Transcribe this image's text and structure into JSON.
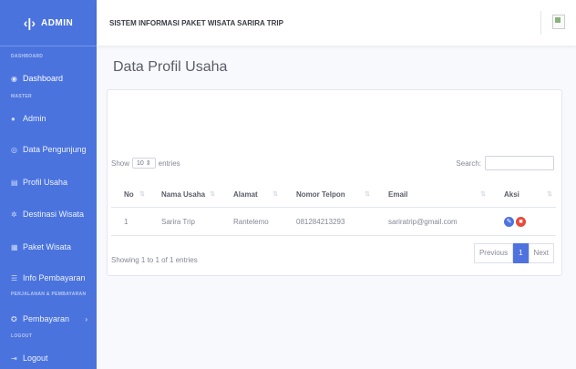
{
  "brand": {
    "name": "ADMIN",
    "logo": "‹|›"
  },
  "sidebar": {
    "sections": [
      "DASHBOARD",
      "MASTER",
      "PERJALANAN & PEMBAYARAN",
      "LOGOUT"
    ],
    "items": [
      {
        "label": "Dashboard",
        "icon": "dashboard-icon"
      },
      {
        "label": "Admin",
        "icon": "user-icon"
      },
      {
        "label": "Data Pengunjung",
        "icon": "users-icon"
      },
      {
        "label": "Profil Usaha",
        "icon": "building-icon"
      },
      {
        "label": "Destinasi Wisata",
        "icon": "map-icon"
      },
      {
        "label": "Paket Wisata",
        "icon": "package-icon"
      },
      {
        "label": "Info Pembayaran",
        "icon": "list-icon"
      },
      {
        "label": "Pembayaran",
        "icon": "money-icon"
      },
      {
        "label": "Logout",
        "icon": "logout-icon"
      }
    ]
  },
  "topbar": {
    "title": "SISTEM INFORMASI PAKET WISATA SARIRA TRIP"
  },
  "page": {
    "title": "Data Profil Usaha"
  },
  "table_controls": {
    "show_label": "Show",
    "entries_value": "10",
    "entries_label": "entries",
    "search_label": "Search:"
  },
  "table": {
    "headers": [
      "No",
      "Nama Usaha",
      "Alamat",
      "Nomor Telpon",
      "Email",
      "Aksi"
    ],
    "rows": [
      [
        "1",
        "Sarira Trip",
        "Rantelemo",
        "081284213293",
        "sariratrip@gmail.com"
      ]
    ]
  },
  "footer": {
    "info": "Showing 1 to 1 of 1 entries",
    "prev": "Previous",
    "page": "1",
    "next": "Next"
  },
  "colors": {
    "sidebar": "#4a73de",
    "edit": "#4e73df",
    "delete": "#e74a3b"
  }
}
